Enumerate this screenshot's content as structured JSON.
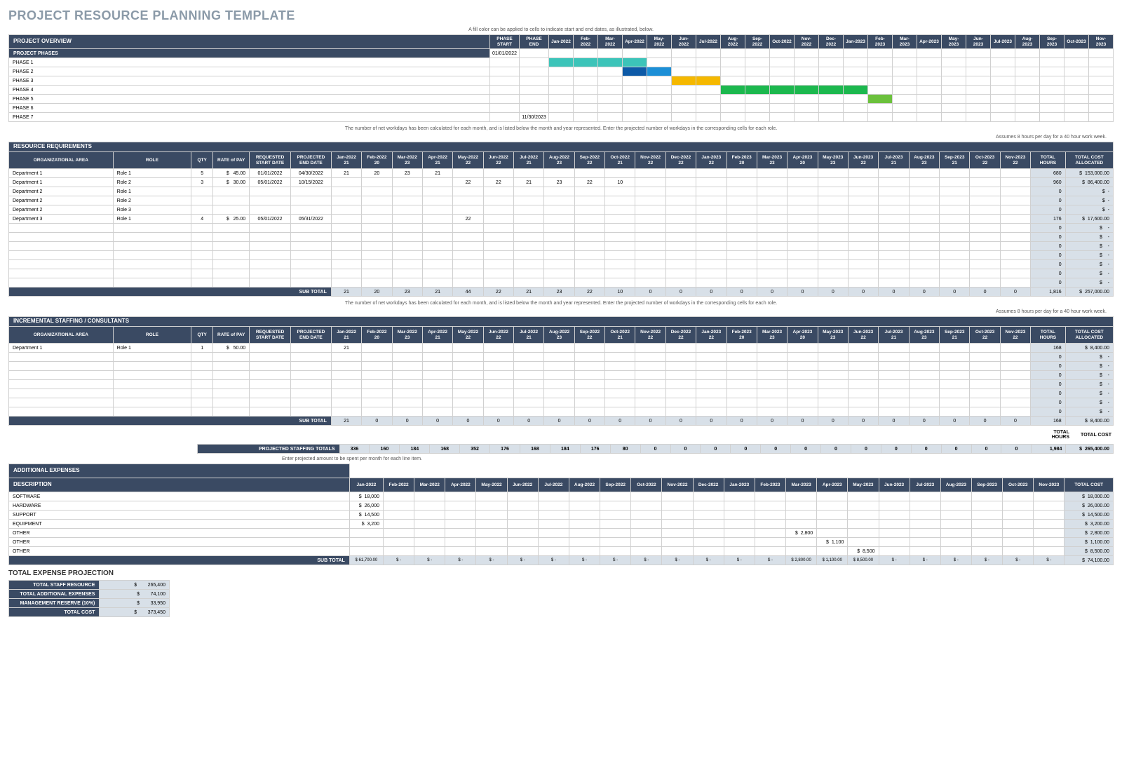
{
  "title": "PROJECT RESOURCE PLANNING TEMPLATE",
  "months": [
    "Jan-2022",
    "Feb-2022",
    "Mar-2022",
    "Apr-2022",
    "May-2022",
    "Jun-2022",
    "Jul-2022",
    "Aug-2022",
    "Sep-2022",
    "Oct-2022",
    "Nov-2022",
    "Dec-2022",
    "Jan-2023",
    "Feb-2023",
    "Mar-2023",
    "Apr-2023",
    "May-2023",
    "Jun-2023",
    "Jul-2023",
    "Aug-2023",
    "Sep-2023",
    "Oct-2023",
    "Nov-2023"
  ],
  "overview": {
    "section": "PROJECT OVERVIEW",
    "note": "A fill color can be applied to cells to indicate start and end dates, as illustrated, below.",
    "phase_start": "PHASE START",
    "phase_end": "PHASE END",
    "phases_label": "PROJECT PHASES",
    "start_date": "01/01/2022",
    "phases": [
      {
        "name": "PHASE 1",
        "start": "",
        "end": "",
        "color": "phase-teal",
        "from": 0,
        "to": 4
      },
      {
        "name": "PHASE 2",
        "start": "",
        "end": "",
        "color": "phase-blue",
        "from": 3,
        "to": 5,
        "darker_from": 3,
        "darker_to": 4
      },
      {
        "name": "PHASE 3",
        "start": "",
        "end": "",
        "color": "phase-yellow",
        "from": 5,
        "to": 7
      },
      {
        "name": "PHASE 4",
        "start": "",
        "end": "",
        "color": "phase-green",
        "from": 7,
        "to": 13
      },
      {
        "name": "PHASE 5",
        "start": "",
        "end": "",
        "color": "phase-limegreen",
        "from": 13,
        "to": 14
      },
      {
        "name": "PHASE 6",
        "start": "",
        "end": ""
      },
      {
        "name": "PHASE 7",
        "start": "",
        "end": "11/30/2023"
      }
    ]
  },
  "resource": {
    "section": "RESOURCE REQUIREMENTS",
    "note": "The number of net workdays has been calculated for each month, and is listed below the month and year represented. Enter the projected number of workdays in the corresponding cells for each role.",
    "assume": "Assumes 8 hours per day for a 40 hour work week.",
    "headers": {
      "org": "ORGANIZATIONAL AREA",
      "role": "ROLE",
      "qty": "QTY",
      "rate": "RATE of PAY",
      "rstart": "REQUESTED START DATE",
      "rend": "PROJECTED END DATE",
      "thours": "TOTAL HOURS",
      "tcost": "TOTAL COST ALLOCATED"
    },
    "workdays": [
      "21",
      "20",
      "23",
      "21",
      "22",
      "22",
      "21",
      "23",
      "22",
      "21",
      "22",
      "22",
      "22",
      "20",
      "23",
      "20",
      "23",
      "22",
      "21",
      "23",
      "21",
      "22",
      "22"
    ],
    "rows": [
      {
        "org": "Department 1",
        "role": "Role 1",
        "qty": "5",
        "rate": "45.00",
        "start": "01/01/2022",
        "end": "04/30/2022",
        "vals": {
          "0": "21",
          "1": "20",
          "2": "23",
          "3": "21"
        },
        "hours": "680",
        "cost": "153,000.00"
      },
      {
        "org": "Department 1",
        "role": "Role 2",
        "qty": "3",
        "rate": "30.00",
        "start": "05/01/2022",
        "end": "10/15/2022",
        "vals": {
          "4": "22",
          "5": "22",
          "6": "21",
          "7": "23",
          "8": "22",
          "9": "10"
        },
        "hours": "960",
        "cost": "86,400.00"
      },
      {
        "org": "Department 2",
        "role": "Role 1",
        "qty": "",
        "rate": "",
        "start": "",
        "end": "",
        "vals": {},
        "hours": "0",
        "cost": "-"
      },
      {
        "org": "Department 2",
        "role": "Role 2",
        "qty": "",
        "rate": "",
        "start": "",
        "end": "",
        "vals": {},
        "hours": "0",
        "cost": "-"
      },
      {
        "org": "Department 2",
        "role": "Role 3",
        "qty": "",
        "rate": "",
        "start": "",
        "end": "",
        "vals": {},
        "hours": "0",
        "cost": "-"
      },
      {
        "org": "Department 3",
        "role": "Role 1",
        "qty": "4",
        "rate": "25.00",
        "start": "05/01/2022",
        "end": "05/31/2022",
        "vals": {
          "4": "22"
        },
        "hours": "176",
        "cost": "17,600.00"
      }
    ],
    "emptyRows": 7,
    "subtotal_label": "SUB TOTAL",
    "subtotal": [
      "21",
      "20",
      "23",
      "21",
      "44",
      "22",
      "21",
      "23",
      "22",
      "10",
      "0",
      "0",
      "0",
      "0",
      "0",
      "0",
      "0",
      "0",
      "0",
      "0",
      "0",
      "0",
      "0"
    ],
    "subtotal_hours": "1,816",
    "subtotal_cost": "257,000.00"
  },
  "incremental": {
    "section": "INCREMENTAL STAFFING / CONSULTANTS",
    "rows": [
      {
        "org": "Department 1",
        "role": "Role 1",
        "qty": "1",
        "rate": "50.00",
        "start": "",
        "end": "",
        "vals": {
          "0": "21"
        },
        "hours": "168",
        "cost": "8,400.00"
      }
    ],
    "emptyRows": 7,
    "subtotal": [
      "21",
      "0",
      "0",
      "0",
      "0",
      "0",
      "0",
      "0",
      "0",
      "0",
      "0",
      "0",
      "0",
      "0",
      "0",
      "0",
      "0",
      "0",
      "0",
      "0",
      "0",
      "0",
      "0"
    ],
    "subtotal_hours": "168",
    "subtotal_cost": "8,400.00"
  },
  "staffing_totals": {
    "label": "PROJECTED STAFFING TOTALS",
    "thours_label": "TOTAL HOURS",
    "tcost_label": "TOTAL COST",
    "vals": [
      "336",
      "160",
      "184",
      "168",
      "352",
      "176",
      "168",
      "184",
      "176",
      "80",
      "0",
      "0",
      "0",
      "0",
      "0",
      "0",
      "0",
      "0",
      "0",
      "0",
      "0",
      "0",
      "0"
    ],
    "hours": "1,984",
    "cost": "265,400.00"
  },
  "expenses": {
    "section": "ADDITIONAL EXPENSES",
    "note": "Enter projected amount to be spent per month for each line item.",
    "desc_header": "DESCRIPTION",
    "tcost_header": "TOTAL COST",
    "rows": [
      {
        "desc": "SOFTWARE",
        "vals": {
          "0": "18,000"
        },
        "total": "18,000.00"
      },
      {
        "desc": "HARDWARE",
        "vals": {
          "0": "26,000"
        },
        "total": "26,000.00"
      },
      {
        "desc": "SUPPORT",
        "vals": {
          "0": "14,500"
        },
        "total": "14,500.00"
      },
      {
        "desc": "EQUIPMENT",
        "vals": {
          "0": "3,200"
        },
        "total": "3,200.00"
      },
      {
        "desc": "OTHER",
        "vals": {
          "14": "2,800"
        },
        "total": "2,800.00"
      },
      {
        "desc": "OTHER",
        "vals": {
          "15": "1,100"
        },
        "total": "1,100.00"
      },
      {
        "desc": "OTHER",
        "vals": {
          "16": "8,500"
        },
        "total": "8,500.00"
      }
    ],
    "subtotal": [
      "$ 61,700.00",
      "$     -",
      "$     -",
      "$     -",
      "$     -",
      "$     -",
      "$     -",
      "$     -",
      "$     -",
      "$     -",
      "$     -",
      "$     -",
      "$     -",
      "$     -",
      "$ 2,800.00",
      "$ 1,100.00",
      "$ 8,500.00",
      "$     -",
      "$     -",
      "$     -",
      "$     -",
      "$     -",
      "$     -"
    ],
    "subtotal_total": "74,100.00"
  },
  "summary": {
    "title": "TOTAL EXPENSE PROJECTION",
    "rows": [
      {
        "label": "TOTAL STAFF RESOURCE",
        "val": "265,400"
      },
      {
        "label": "TOTAL ADDITIONAL EXPENSES",
        "val": "74,100"
      },
      {
        "label": "MANAGEMENT RESERVE (10%)",
        "val": "33,950"
      },
      {
        "label": "TOTAL COST",
        "val": "373,450"
      }
    ]
  }
}
